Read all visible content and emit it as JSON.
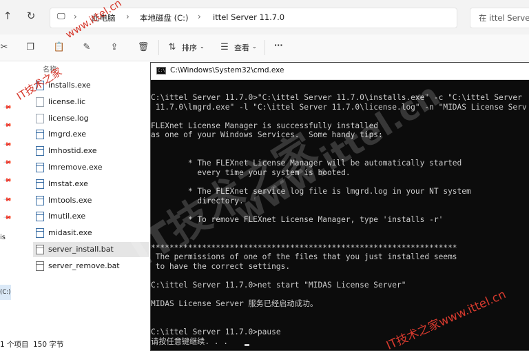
{
  "address_bar": {
    "up_icon": "up-arrow-icon",
    "refresh_icon": "refresh-icon",
    "monitor_icon": "monitor-icon",
    "crumbs": [
      "此电脑",
      "本地磁盘 (C:)",
      "ittel Server 11.7.0"
    ],
    "search_placeholder": "在 ittel Server"
  },
  "toolbar": {
    "sort_label": "排序",
    "view_label": "查看",
    "more_label": "···"
  },
  "file_list": {
    "column_header": "名称",
    "files": [
      {
        "name": "installs.exe",
        "type": "exe"
      },
      {
        "name": "license.lic",
        "type": "doc"
      },
      {
        "name": "license.log",
        "type": "doc"
      },
      {
        "name": "lmgrd.exe",
        "type": "exe"
      },
      {
        "name": "lmhostid.exe",
        "type": "exe"
      },
      {
        "name": "lmremove.exe",
        "type": "exe"
      },
      {
        "name": "lmstat.exe",
        "type": "exe"
      },
      {
        "name": "lmtools.exe",
        "type": "exe"
      },
      {
        "name": "lmutil.exe",
        "type": "exe"
      },
      {
        "name": "midasit.exe",
        "type": "exe"
      },
      {
        "name": "server_install.bat",
        "type": "bat",
        "selected": true
      },
      {
        "name": "server_remove.bat",
        "type": "bat"
      }
    ]
  },
  "nav_pane": {
    "drive_label": "(C:)",
    "cut_label": "is"
  },
  "status_bar": {
    "item_count": "1 个项目",
    "selection_size": "150 字节"
  },
  "cmd": {
    "title": "C:\\Windows\\System32\\cmd.exe",
    "lines": [
      "C:\\ittel Server 11.7.0>\"C:\\ittel Server 11.7.0\\installs.exe\" -c \"C:\\ittel Server",
      " 11.7.0\\lmgrd.exe\" -l \"C:\\ittel Server 11.7.0\\license.log\" -n \"MIDAS License Serv",
      "",
      "FLEXnet License Manager is successfully installed",
      "as one of your Windows Services.  Some handy tips:",
      "",
      "",
      "        * The FLEXnet License Manager will be automatically started",
      "          every time your system is booted.",
      "",
      "        * The FLEXnet service log file is lmgrd.log in your NT system",
      "          directory.",
      "",
      "        * To remove FLEXnet License Manager, type 'installs -r'",
      "",
      "",
      "******************************************************************",
      " The permissions of one of the files that you just installed seems",
      " to have the correct settings.",
      "",
      "C:\\ittel Server 11.7.0>net start \"MIDAS License Server\"",
      "",
      "MIDAS License Server 服务已经启动成功。",
      "",
      "",
      "C:\\ittel Server 11.7.0>pause",
      "请按任意键继续. . . "
    ]
  },
  "watermarks": {
    "top": "www.ittel.cn",
    "left": "IT技术之家",
    "ghost_center": "IT技术之家",
    "ghost_url": "www.ittel.cn",
    "bottom_right": "IT技术之家www.ittel.cn"
  },
  "colors": {
    "cmd_bg": "#0c0c0c",
    "cmd_fg": "#cccccc",
    "watermark": "#d63a2e",
    "selected_row": "#e5e5e5"
  }
}
